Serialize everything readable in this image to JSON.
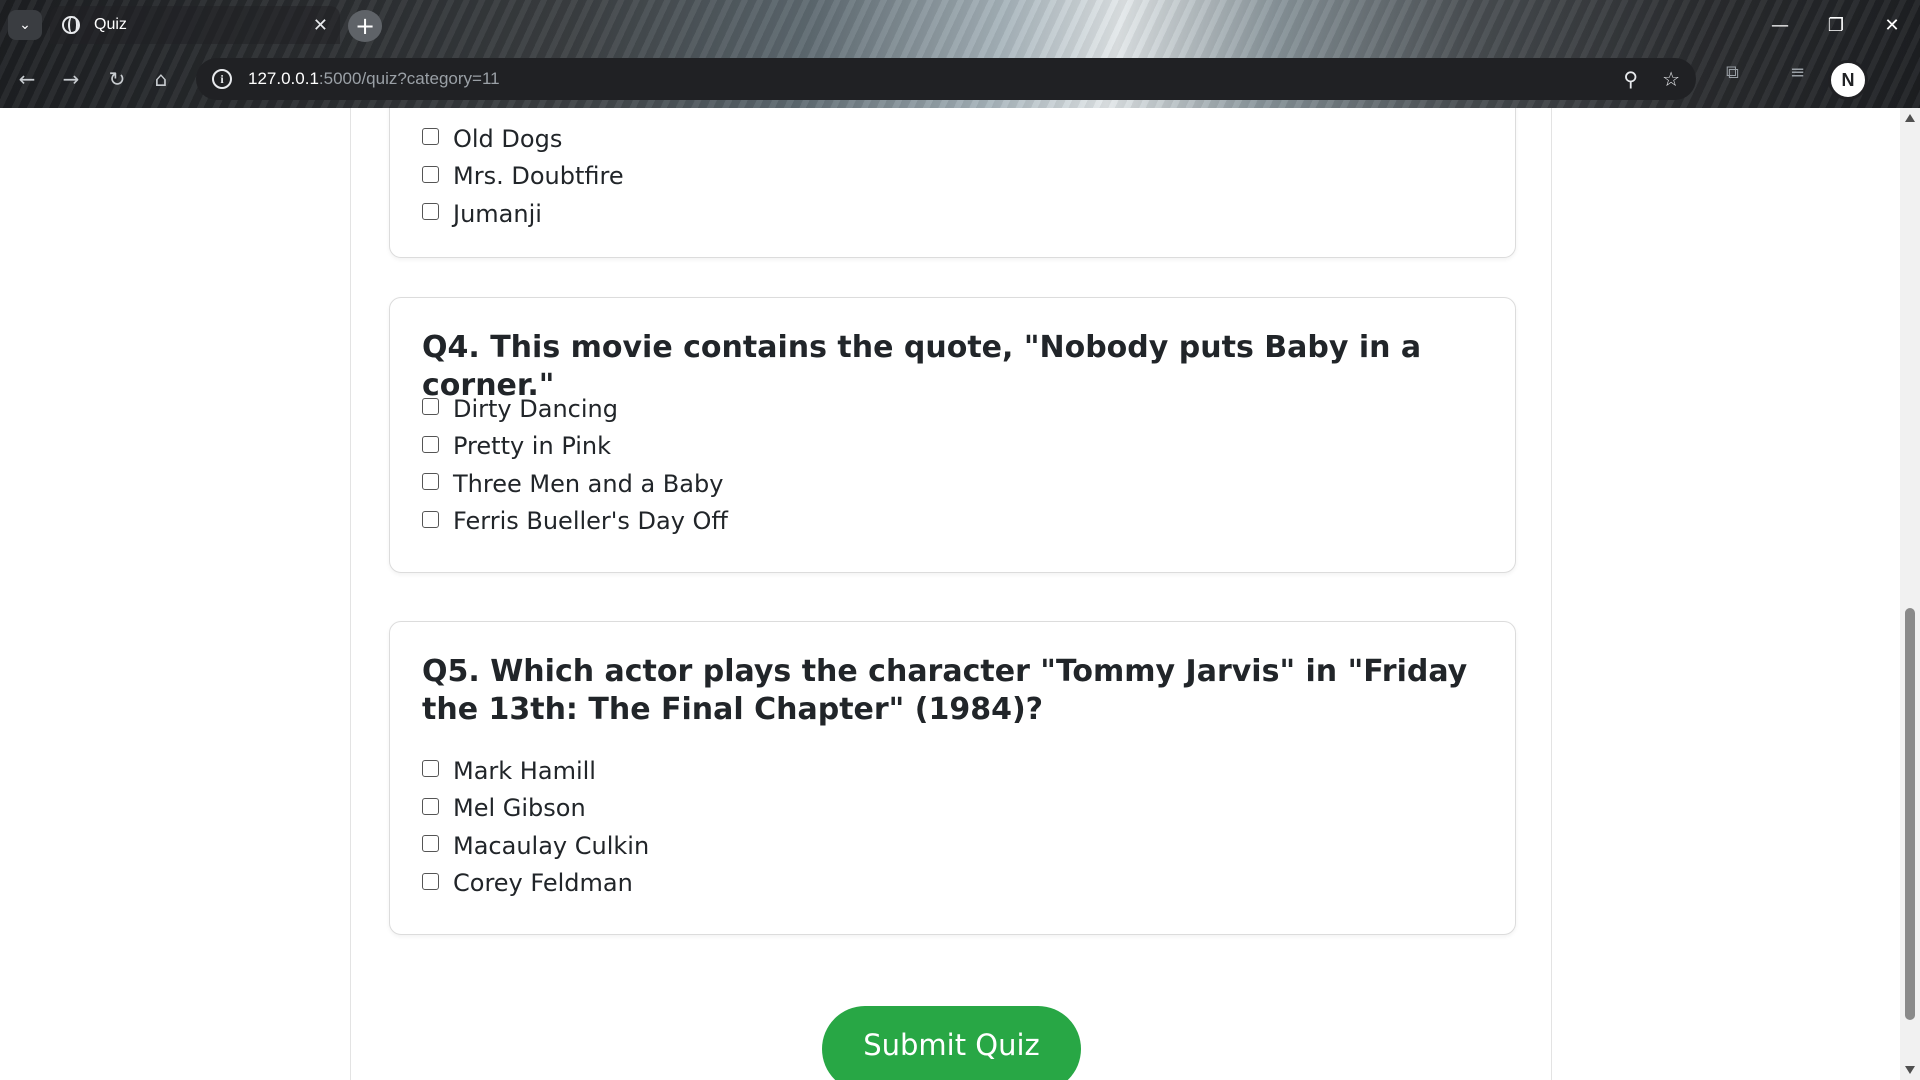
{
  "browser": {
    "tab_title": "Quiz",
    "url_host": "127.0.0.1",
    "url_rest": ":5000/quiz?category=11",
    "profile_initial": "N"
  },
  "partial_question": {
    "options": [
      "Old Dogs",
      "Mrs. Doubtfire",
      "Jumanji"
    ]
  },
  "questions": [
    {
      "text": "Q4. This movie contains the quote, \"Nobody puts Baby in a corner.\"",
      "options": [
        "Dirty Dancing",
        "Pretty in Pink",
        "Three Men and a Baby",
        "Ferris Bueller's Day Off"
      ]
    },
    {
      "text": "Q5. Which actor plays the character \"Tommy Jarvis\" in \"Friday the 13th: The Final Chapter\" (1984)?",
      "options": [
        "Mark Hamill",
        "Mel Gibson",
        "Macaulay Culkin",
        "Corey Feldman"
      ]
    }
  ],
  "submit_label": "Submit Quiz",
  "colors": {
    "submit": "#28a745",
    "text": "#212529"
  }
}
